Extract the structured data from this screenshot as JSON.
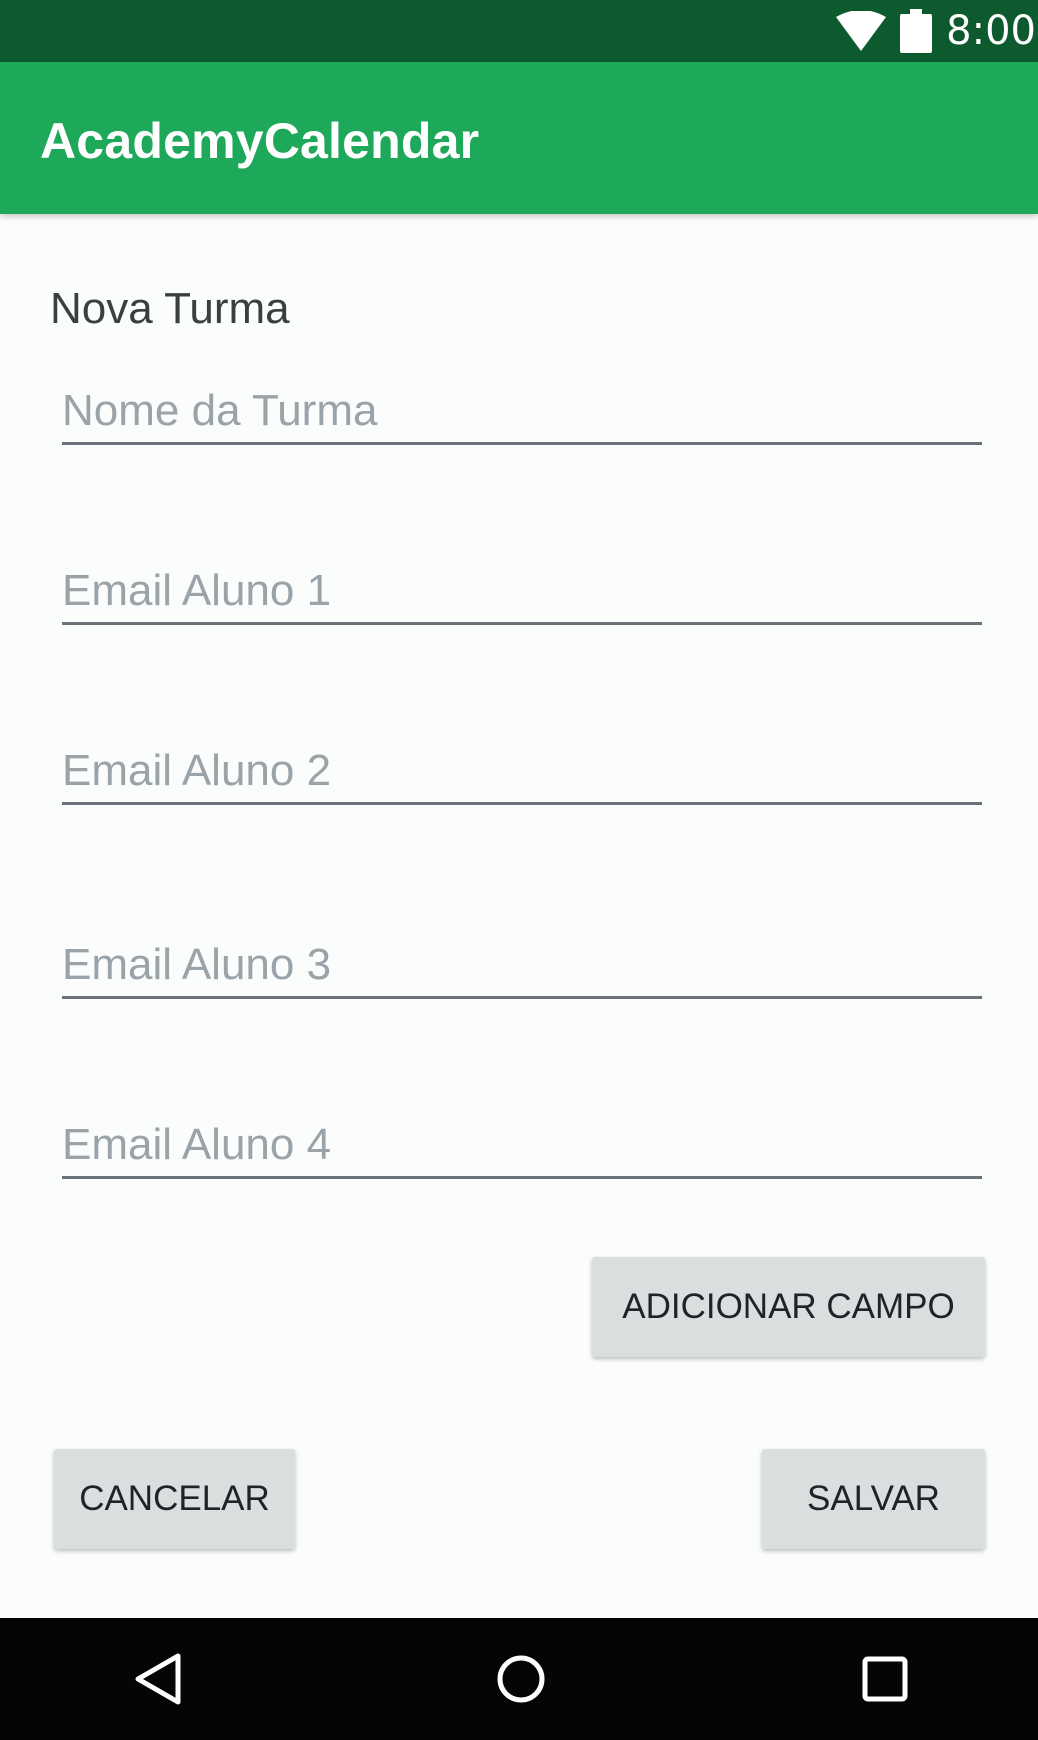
{
  "status_bar": {
    "time": "8:00",
    "icons": [
      "wifi-icon",
      "battery-icon"
    ]
  },
  "app_bar": {
    "title": "AcademyCalendar"
  },
  "form": {
    "heading": "Nova Turma",
    "fields": [
      {
        "placeholder": "Nome da Turma",
        "value": ""
      },
      {
        "placeholder": "Email Aluno 1",
        "value": ""
      },
      {
        "placeholder": "Email Aluno 2",
        "value": ""
      },
      {
        "placeholder": "Email Aluno 3",
        "value": ""
      },
      {
        "placeholder": "Email Aluno 4",
        "value": ""
      }
    ],
    "add_field_label": "ADICIONAR CAMPO",
    "cancel_label": "CANCELAR",
    "save_label": "SALVAR"
  },
  "nav_bar": {
    "icons": [
      "back-icon",
      "home-icon",
      "recents-icon"
    ]
  },
  "colors": {
    "status_bar": "#0d5a2e",
    "app_bar": "#1ea85a",
    "background": "#fbfcfc",
    "button": "#d9dfdf",
    "nav_bar": "#040507"
  }
}
